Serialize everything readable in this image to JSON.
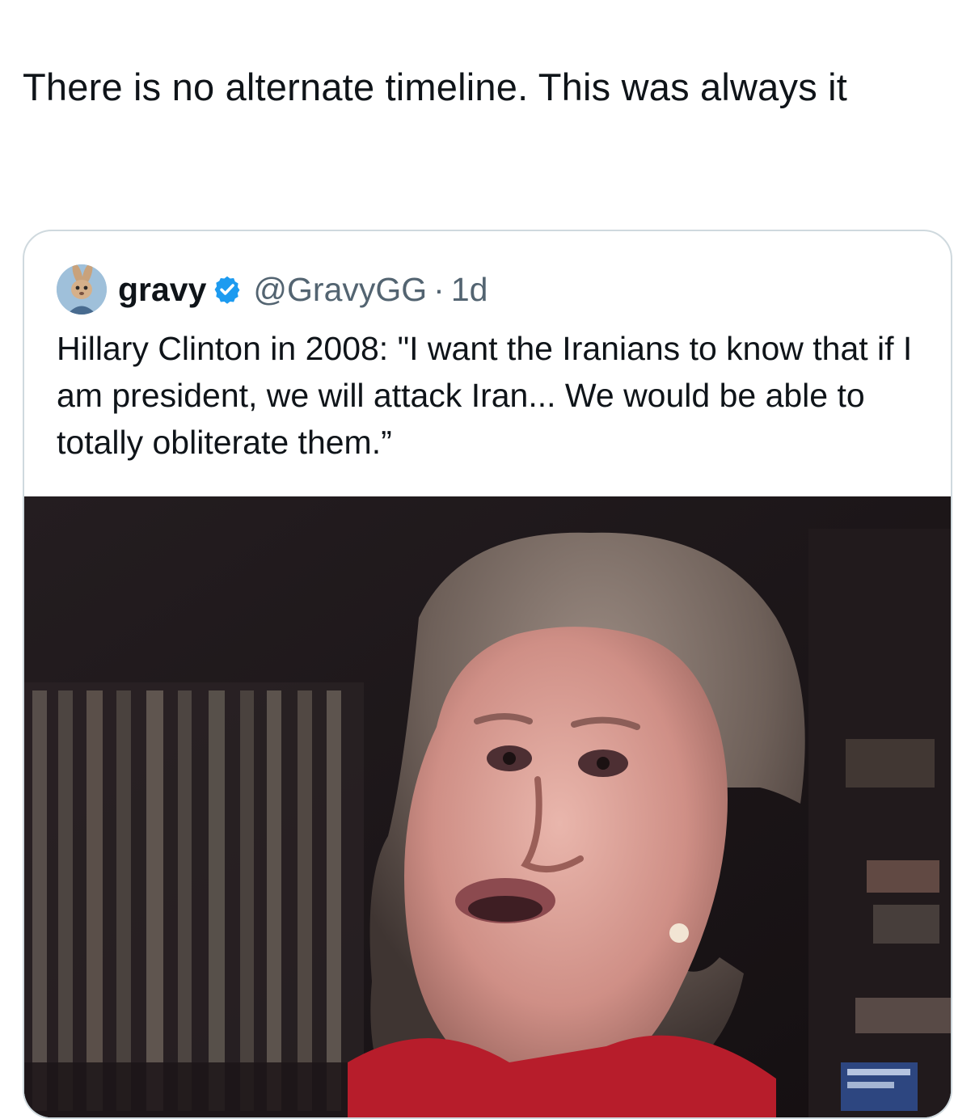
{
  "post": {
    "text": "There is no alternate timeline. This was always it"
  },
  "quoted_post": {
    "display_name": "gravy",
    "verified": true,
    "handle": "@GravyGG",
    "separator": "·",
    "time": "1d",
    "text": "Hillary Clinton in 2008: \"I want the Iranians to know that if I am president, we will attack Iran... We would be able to totally obliterate them.”",
    "media": {
      "kind": "video-frame",
      "icons": [
        "avatar-rabbit-icon",
        "verified-badge-icon"
      ]
    }
  },
  "colors": {
    "text": "#0f1419",
    "secondary_text": "#536471",
    "verified_badge": "#1d9bf0",
    "card_border": "#cfd9de"
  }
}
